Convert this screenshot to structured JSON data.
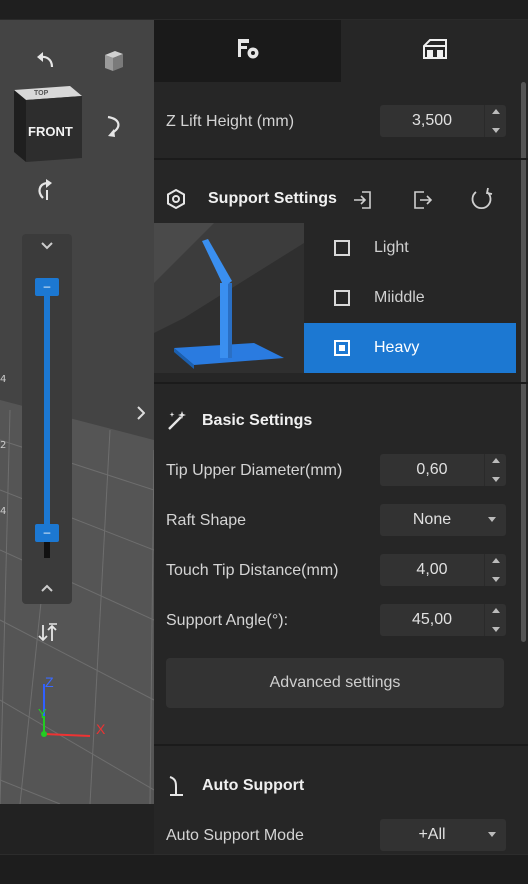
{
  "tabs": [
    {
      "name": "slice-settings-tab",
      "icon": "file-gear-icon"
    },
    {
      "name": "support-tab",
      "icon": "support-structure-icon"
    }
  ],
  "z_lift": {
    "label": "Z Lift Height (mm)",
    "value": "3,500"
  },
  "support_settings": {
    "title": "Support Settings",
    "options": [
      {
        "label": "Light",
        "selected": false
      },
      {
        "label": "Miiddle",
        "selected": false
      },
      {
        "label": "Heavy",
        "selected": true
      }
    ]
  },
  "basic_settings": {
    "title": "Basic Settings",
    "tip_upper": {
      "label": "Tip Upper Diameter(mm)",
      "value": "0,60"
    },
    "raft_shape": {
      "label": "Raft Shape",
      "value": "None"
    },
    "touch_tip": {
      "label": "Touch Tip Distance(mm)",
      "value": "4,00"
    },
    "support_angle": {
      "label": "Support Angle(°):",
      "value": "45,00"
    },
    "advanced_button": "Advanced settings"
  },
  "auto_support": {
    "title": "Auto Support",
    "mode": {
      "label": "Auto Support Mode",
      "value": "+All"
    }
  },
  "view_cube": {
    "front": "FRONT",
    "top": "TOP"
  },
  "axes": {
    "x": "X",
    "y": "Y",
    "z": "Z"
  },
  "colors": {
    "accent": "#1c78d2",
    "panel": "#262626",
    "viewport": "#444444"
  }
}
